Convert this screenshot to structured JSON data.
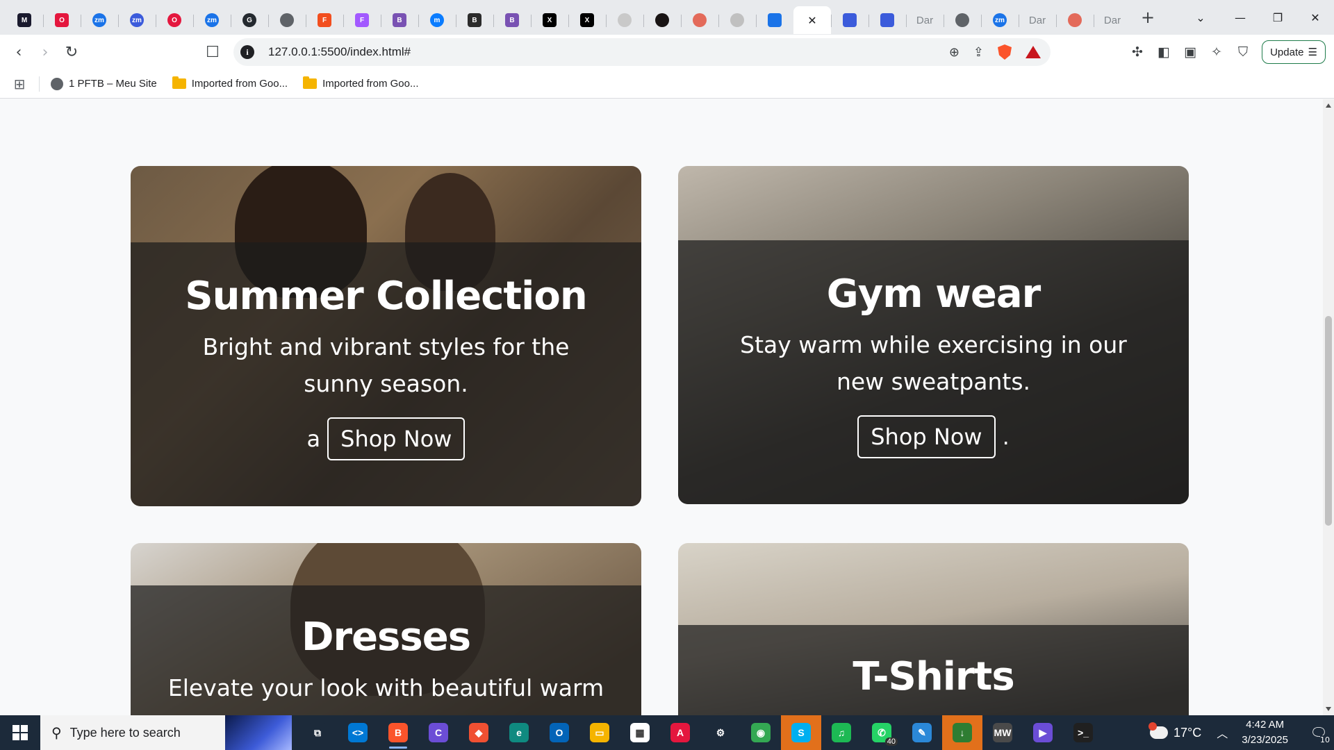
{
  "browser": {
    "tabs": [
      {
        "icon": "tab-favicon-dark",
        "color": "#1a1a2e",
        "label": "",
        "glyph": "M"
      },
      {
        "icon": "tab-favicon-red",
        "color": "#e4173e",
        "label": "",
        "glyph": "O"
      },
      {
        "icon": "tab-favicon-zm",
        "color": "#1a73e8",
        "label": "",
        "glyph": "zm"
      },
      {
        "icon": "tab-favicon-zm",
        "color": "#3b5bdb",
        "label": "",
        "glyph": "zm"
      },
      {
        "icon": "tab-favicon-opera",
        "color": "#e4173e",
        "label": "",
        "glyph": "O"
      },
      {
        "icon": "tab-favicon-zm",
        "color": "#1a73e8",
        "label": "",
        "glyph": "zm"
      },
      {
        "icon": "tab-favicon-github",
        "color": "#24292f",
        "label": "",
        "glyph": "G"
      },
      {
        "icon": "tab-favicon-globe",
        "color": "#5f6368",
        "label": "",
        "glyph": ""
      },
      {
        "icon": "tab-favicon-figma",
        "color": "#f24e1e",
        "label": "",
        "glyph": "F"
      },
      {
        "icon": "tab-favicon-figma",
        "color": "#a259ff",
        "label": "",
        "glyph": "F"
      },
      {
        "icon": "tab-favicon-bootstrap",
        "color": "#7952b3",
        "label": "",
        "glyph": "B"
      },
      {
        "icon": "tab-favicon-messenger",
        "color": "#0a7cff",
        "label": "",
        "glyph": "m"
      },
      {
        "icon": "tab-favicon-bootstrap",
        "color": "#2b2b2b",
        "label": "",
        "glyph": "B"
      },
      {
        "icon": "tab-favicon-bootstrap",
        "color": "#7952b3",
        "label": "",
        "glyph": "B"
      },
      {
        "icon": "tab-favicon-x",
        "color": "#000000",
        "label": "",
        "glyph": "X"
      },
      {
        "icon": "tab-favicon-x",
        "color": "#000000",
        "label": "",
        "glyph": "X"
      },
      {
        "icon": "tab-favicon-shield",
        "color": "#c9c9c9",
        "label": "",
        "glyph": ""
      },
      {
        "icon": "tab-favicon-spotify",
        "color": "#191414",
        "label": "",
        "glyph": ""
      },
      {
        "icon": "tab-favicon-shield",
        "color": "#e36a5a",
        "label": "",
        "glyph": ""
      },
      {
        "icon": "tab-favicon-loader",
        "color": "#c0c0c0",
        "label": "",
        "glyph": ""
      },
      {
        "icon": "tab-favicon-flag",
        "color": "#1a73e8",
        "label": "",
        "glyph": ""
      },
      {
        "icon": "tab-close-icon",
        "color": "",
        "label": "",
        "glyph": "✕",
        "active": true
      },
      {
        "icon": "tab-favicon-cursor",
        "color": "#3b5bdb",
        "label": "",
        "glyph": ""
      },
      {
        "icon": "tab-favicon-cursor",
        "color": "#3b5bdb",
        "label": "",
        "glyph": ""
      },
      {
        "icon": "tab-favicon-text",
        "color": "",
        "label": "Dar",
        "glyph": ""
      },
      {
        "icon": "tab-favicon-globe",
        "color": "#5f6368",
        "label": "",
        "glyph": ""
      },
      {
        "icon": "tab-favicon-zm",
        "color": "#1a73e8",
        "label": "",
        "glyph": "zm"
      },
      {
        "icon": "tab-favicon-text",
        "color": "",
        "label": "Dar",
        "glyph": ""
      },
      {
        "icon": "tab-favicon-shield",
        "color": "#e36a5a",
        "label": "",
        "glyph": ""
      },
      {
        "icon": "tab-favicon-text",
        "color": "",
        "label": "Dar",
        "glyph": ""
      }
    ],
    "new_tab": "+",
    "url": "127.0.0.1:5500/index.html#",
    "update_label": "Update",
    "bookmarks": [
      {
        "label": "1 PFTB – Meu Site",
        "icon": "globe"
      },
      {
        "label": "Imported from Goo...",
        "icon": "folder"
      },
      {
        "label": "Imported from Goo...",
        "icon": "folder"
      }
    ]
  },
  "page": {
    "cards": [
      {
        "title": "Summer Collection",
        "text": "Bright and vibrant styles for the sunny season.",
        "prefix": "a",
        "button": "Shop Now",
        "suffix": ""
      },
      {
        "title": "Gym wear",
        "text": "Stay warm while exercising in our new sweatpants.",
        "prefix": "",
        "button": "Shop Now",
        "suffix": "."
      },
      {
        "title": "Dresses",
        "text": "Elevate your look with beautiful warm",
        "prefix": "",
        "button": "",
        "suffix": ""
      },
      {
        "title": "T-Shirts",
        "text": "",
        "prefix": "",
        "button": "",
        "suffix": ""
      }
    ]
  },
  "taskbar": {
    "search_placeholder": "Type here to search",
    "apps": [
      {
        "name": "task-view",
        "color": "#1c2a3a",
        "glyph": "⧉"
      },
      {
        "name": "vscode",
        "color": "#0078d4",
        "glyph": "<>"
      },
      {
        "name": "brave",
        "color": "#fb542b",
        "glyph": "B",
        "running": true
      },
      {
        "name": "copilot",
        "color": "#6b4dd6",
        "glyph": "C"
      },
      {
        "name": "git",
        "color": "#f05032",
        "glyph": "◆"
      },
      {
        "name": "edge",
        "color": "#0f8a80",
        "glyph": "e"
      },
      {
        "name": "outlook",
        "color": "#0364b8",
        "glyph": "O"
      },
      {
        "name": "file-explorer",
        "color": "#f5b400",
        "glyph": "▭"
      },
      {
        "name": "ms-store",
        "color": "#ffffff",
        "glyph": "▦"
      },
      {
        "name": "app-red",
        "color": "#e4173e",
        "glyph": "A"
      },
      {
        "name": "settings",
        "color": "#1c2a3a",
        "glyph": "⚙"
      },
      {
        "name": "chrome",
        "color": "#34a853",
        "glyph": "◉"
      },
      {
        "name": "skype",
        "color": "#00aff0",
        "glyph": "S",
        "highlight": true
      },
      {
        "name": "spotify",
        "color": "#1db954",
        "glyph": "♫"
      },
      {
        "name": "whatsapp",
        "color": "#25d366",
        "glyph": "✆",
        "badge": "40"
      },
      {
        "name": "paint",
        "color": "#2b88d8",
        "glyph": "✎"
      },
      {
        "name": "app-download",
        "color": "#2e7d32",
        "glyph": "↓",
        "highlight": true
      },
      {
        "name": "mw-app",
        "color": "#4a4a4a",
        "glyph": "MW"
      },
      {
        "name": "media-player",
        "color": "#6b4dd6",
        "glyph": "▶"
      },
      {
        "name": "terminal",
        "color": "#202020",
        "glyph": ">_"
      }
    ],
    "temperature": "17°C",
    "time": "4:42 AM",
    "date": "3/23/2025",
    "notifications": "10"
  }
}
